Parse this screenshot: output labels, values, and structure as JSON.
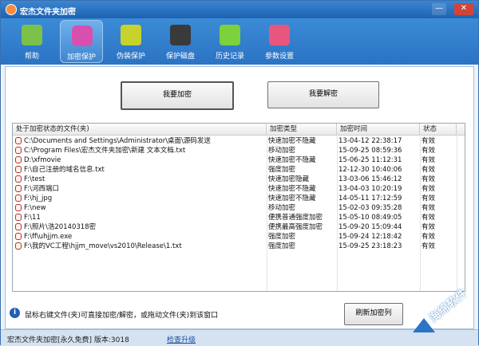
{
  "window": {
    "title": "宏杰文件夹加密",
    "min": "—",
    "close": "✕"
  },
  "toolbar": {
    "items": [
      {
        "label": "帮助",
        "icon": "house-icon",
        "color": "#7cc24a"
      },
      {
        "label": "加密保护",
        "icon": "lock-icon",
        "color": "#d94fb0"
      },
      {
        "label": "伪装保护",
        "icon": "book-icon",
        "color": "#c8d22d"
      },
      {
        "label": "保护磁盘",
        "icon": "disk-icon",
        "color": "#3a3a3a"
      },
      {
        "label": "历史记录",
        "icon": "grid-icon",
        "color": "#7cd23a"
      },
      {
        "label": "参数设置",
        "icon": "wrench-icon",
        "color": "#e8567e"
      }
    ],
    "active_index": 1
  },
  "actions": {
    "encrypt": "我要加密",
    "decrypt": "我要解密"
  },
  "table": {
    "columns": [
      "处于加密状态的文件(夹)",
      "加密类型",
      "加密时间",
      "状态"
    ],
    "rows": [
      [
        "C:\\Documents and Settings\\Administrator\\桌面\\源码发送",
        "快速加密不隐藏",
        "13-04-12 22:38:17",
        "有效"
      ],
      [
        "C:\\Program Files\\宏杰文件夹加密\\新建 文本文档.txt",
        "移动加密",
        "15-09-25 08:59:36",
        "有效"
      ],
      [
        "D:\\xfmovie",
        "快速加密不隐藏",
        "15-06-25 11:12:31",
        "有效"
      ],
      [
        "F:\\自己注册的域名信息.txt",
        "强度加密",
        "12-12-30 10:40:06",
        "有效"
      ],
      [
        "F:\\test",
        "快速加密隐藏",
        "13-03-06 15:46:12",
        "有效"
      ],
      [
        "F:\\河西端口",
        "快速加密不隐藏",
        "13-04-03 10:20:19",
        "有效"
      ],
      [
        "F:\\hj_jpg",
        "快速加密不隐藏",
        "14-05-11 17:12:59",
        "有效"
      ],
      [
        "F:\\new",
        "移动加密",
        "15-02-03 09:35:28",
        "有效"
      ],
      [
        "F:\\11",
        "便携普通强度加密",
        "15-05-10 08:49:05",
        "有效"
      ],
      [
        "F:\\照片\\浩20140318密",
        "便携最高强度加密",
        "15-09-20 15:09:44",
        "有效"
      ],
      [
        "F:\\ff\\uhjjm.exe",
        "强度加密",
        "15-09-24 12:18:42",
        "有效"
      ],
      [
        "F:\\我的VC工程\\hjjm_move\\vs2010\\Release\\1.txt",
        "强度加密",
        "15-09-25 23:18:23",
        "有效"
      ]
    ]
  },
  "hint": {
    "icon": "info-icon",
    "text": "鼠标右键文件(夹)可直接加密/解密，或拖动文件(夹)到该窗口",
    "refresh": "刷新加密列"
  },
  "statusbar": {
    "text": "宏杰文件夹加密[永久免费]  版本:3018",
    "link": "检查升级"
  },
  "watermark": {
    "text": "海绵软件"
  }
}
